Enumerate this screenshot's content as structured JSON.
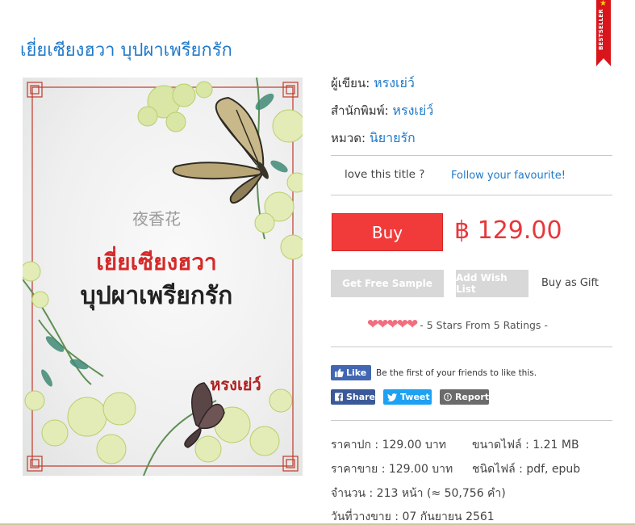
{
  "ribbon": {
    "label": "BESTSELLER",
    "star": "★"
  },
  "book": {
    "title": "เยี่ยเซียงฮวา บุปผาเพรียกรัก",
    "cover": {
      "chinese_title": "夜香花",
      "thai_title_line1": "เยี่ยเซียงฮวา",
      "thai_title_line2": "บุปผาเพรียกรัก",
      "author": "หรงเย่ว์"
    }
  },
  "info": {
    "author_label": "ผู้เขียน:",
    "author_value": "หรงเย่ว์",
    "publisher_label": "สำนักพิมพ์:",
    "publisher_value": "หรงเย่ว์",
    "category_label": "หมวด:",
    "category_value": "นิยายรัก"
  },
  "follow": {
    "question": "love this title ?",
    "link": "Follow your favourite!"
  },
  "purchase": {
    "buy_label": "Buy",
    "price": "฿ 129.00",
    "free_sample": "Get Free Sample",
    "wish_list": "Add Wish List",
    "gift": "Buy as Gift"
  },
  "rating": {
    "hearts": "❤❤❤❤❤",
    "text": "- 5 Stars From 5 Ratings -",
    "stars": 5
  },
  "social": {
    "like": "Like",
    "like_text": "Be the first of your friends to like this.",
    "share": "Share",
    "tweet": "Tweet",
    "report": "Report"
  },
  "details": {
    "cover_price": "ราคาปก : 129.00 บาท",
    "file_size": "ขนาดไฟล์ : 1.21 MB",
    "sale_price": "ราคาขาย : 129.00 บาท",
    "file_type": "ชนิดไฟล์ : pdf, epub",
    "pages": "จำนวน : 213 หน้า (≈ 50,756 คำ)",
    "release_date": "วันที่วางขาย : 07 กันยายน 2561"
  },
  "colors": {
    "link": "#1f79c9",
    "buy": "#f13b3b",
    "price": "#e8373b",
    "ribbon": "#d9141b"
  }
}
